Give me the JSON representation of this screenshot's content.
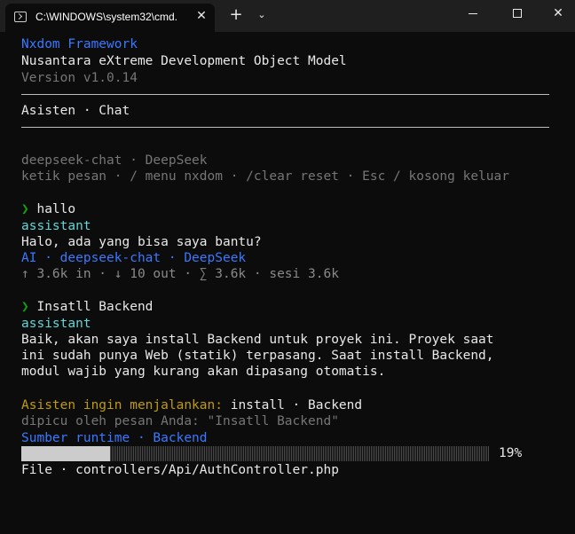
{
  "window": {
    "tab_title": "C:\\WINDOWS\\system32\\cmd.",
    "close_tab_glyph": "✕",
    "new_tab_glyph": "+",
    "dropdown_glyph": "⌄",
    "close_glyph": "✕"
  },
  "header": {
    "framework": "Nxdom Framework",
    "subtitle": "Nusantara eXtreme Development Object Model",
    "version": "Version v1.0.14",
    "section": "Asisten · Chat"
  },
  "model_info": {
    "model": "deepseek-chat · DeepSeek",
    "hints": "ketik pesan · / menu nxdom · /clear reset · Esc / kosong keluar"
  },
  "conversation": [
    {
      "user_prompt": "❯ hallo",
      "role": "assistant",
      "reply": [
        "Halo, ada yang bisa saya bantu?"
      ],
      "meta": "AI · deepseek-chat · DeepSeek",
      "tokens": "↑ 3.6k in · ↓ 10 out · ∑ 3.6k · sesi 3.6k"
    },
    {
      "user_prompt": "❯ Insatll Backend",
      "role": "assistant",
      "reply": [
        "Baik, akan saya install Backend untuk proyek ini. Proyek saat",
        "ini sudah punya Web (statik) terpasang. Saat install Backend,",
        "modul wajib yang kurang akan dipasang otomatis."
      ]
    }
  ],
  "action": {
    "prefix": "Asisten ingin menjalankan:",
    "command": " install · Backend",
    "trigger": "dipicu oleh pesan Anda: \"Insatll Backend\"",
    "runtime": "Sumber runtime · Backend",
    "progress_percent": 19,
    "progress_label": "19%",
    "file_line": "File · controllers/Api/AuthController.php"
  }
}
